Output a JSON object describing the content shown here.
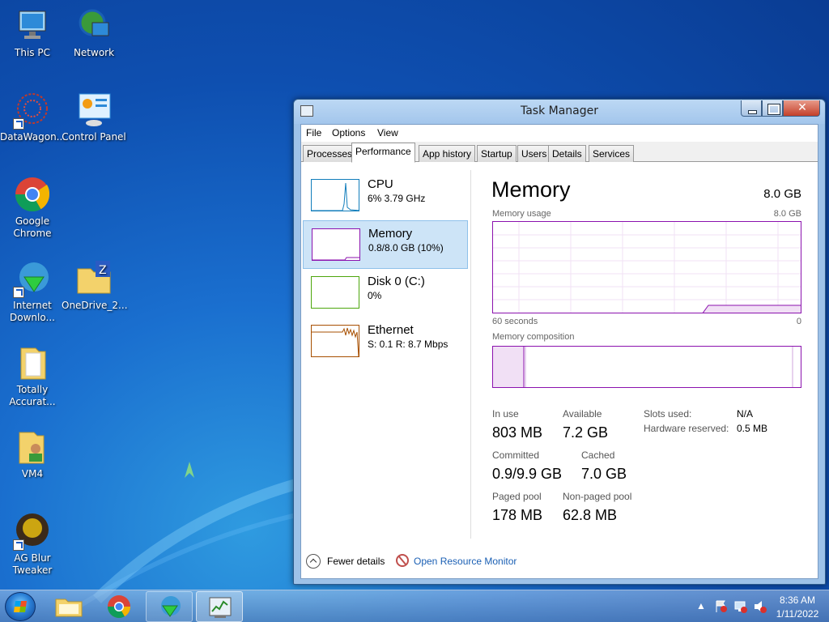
{
  "desktop": {
    "icons": [
      {
        "label": "This PC"
      },
      {
        "label": "Network"
      },
      {
        "label": "DataWagon..."
      },
      {
        "label": "Control Panel"
      },
      {
        "label": "Google Chrome"
      },
      {
        "label": "Internet Downlo..."
      },
      {
        "label": "OneDrive_2..."
      },
      {
        "label": "Totally Accurat..."
      },
      {
        "label": "VM4"
      },
      {
        "label": "AG Blur Tweaker"
      }
    ]
  },
  "window": {
    "title": "Task Manager",
    "close_glyph": "✕"
  },
  "menu": {
    "file": "File",
    "options": "Options",
    "view": "View"
  },
  "tabs": [
    "Processes",
    "Performance",
    "App history",
    "Startup",
    "Users",
    "Details",
    "Services"
  ],
  "sidebar": {
    "items": [
      {
        "name": "CPU",
        "sub": "6%  3.79 GHz",
        "color": "#117dbb"
      },
      {
        "name": "Memory",
        "sub": "0.8/8.0 GB (10%)",
        "color": "#8b12ae"
      },
      {
        "name": "Disk 0 (C:)",
        "sub": "0%",
        "color": "#4da60c"
      },
      {
        "name": "Ethernet",
        "sub": "S: 0.1  R: 8.7 Mbps",
        "color": "#a74f01"
      }
    ]
  },
  "main": {
    "title": "Memory",
    "total": "8.0 GB",
    "usage_label": "Memory usage",
    "usage_max": "8.0 GB",
    "time_left": "60 seconds",
    "time_right": "0",
    "composition_label": "Memory composition",
    "usage_fraction": 0.1
  },
  "stats": {
    "in_use_label": "In use",
    "in_use": "803 MB",
    "available_label": "Available",
    "available": "7.2 GB",
    "committed_label": "Committed",
    "committed": "0.9/9.9 GB",
    "cached_label": "Cached",
    "cached": "7.0 GB",
    "paged_label": "Paged pool",
    "paged": "178 MB",
    "nonpaged_label": "Non-paged pool",
    "nonpaged": "62.8 MB",
    "slots_label": "Slots used:",
    "slots": "N/A",
    "hw_reserved_label": "Hardware reserved:",
    "hw_reserved": "0.5 MB"
  },
  "footer": {
    "fewer": "Fewer details",
    "open_rm": "Open Resource Monitor"
  },
  "taskbar": {
    "time": "8:36 AM",
    "date": "1/11/2022"
  },
  "colors": {
    "memory_accent": "#8b12ae",
    "cpu_accent": "#117dbb",
    "disk_accent": "#4da60c",
    "ethernet_accent": "#a74f01"
  }
}
